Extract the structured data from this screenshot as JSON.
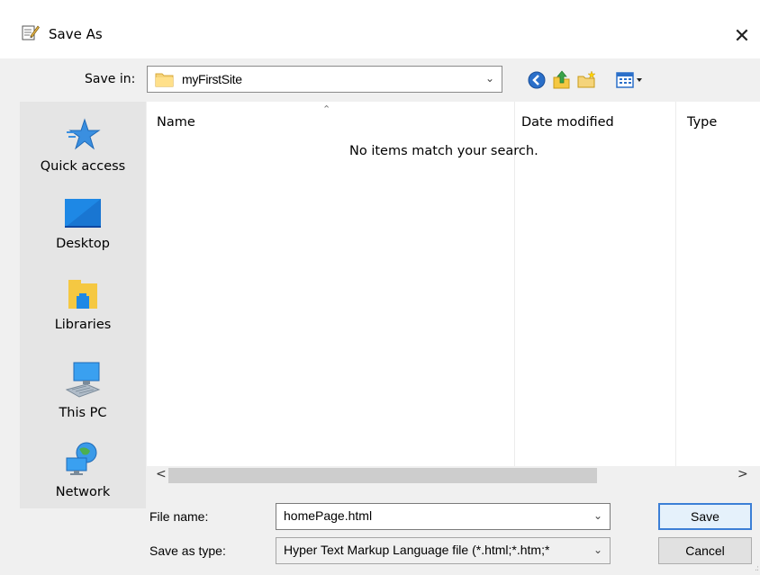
{
  "window": {
    "title": "Save As",
    "close": "✕"
  },
  "save_in": {
    "label": "Save in:",
    "value": "myFirstSite"
  },
  "places": [
    {
      "label": "Quick access",
      "icon": "star-icon"
    },
    {
      "label": "Desktop",
      "icon": "desktop-icon"
    },
    {
      "label": "Libraries",
      "icon": "libraries-icon"
    },
    {
      "label": "This PC",
      "icon": "computer-icon"
    },
    {
      "label": "Network",
      "icon": "network-icon"
    }
  ],
  "file_list": {
    "columns": [
      "Name",
      "Date modified",
      "Type"
    ],
    "empty_message": "No items match your search."
  },
  "scroll": {
    "left": "<",
    "right": ">"
  },
  "file_name": {
    "label": "File name:",
    "value": "homePage.html"
  },
  "save_type": {
    "label": "Save as type:",
    "value": "Hyper Text Markup Language file (*.html;*.htm;*"
  },
  "buttons": {
    "save": "Save",
    "cancel": "Cancel"
  },
  "colors": {
    "accent": "#3c7fd6",
    "places_bg": "#e5e5e5",
    "dialog_bg": "#f0f0f0"
  }
}
